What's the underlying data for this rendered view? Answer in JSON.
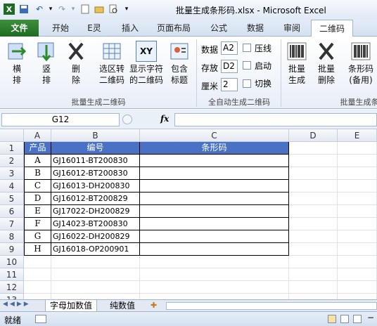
{
  "window": {
    "title": "批量生成条形码.xlsx - Microsoft Excel"
  },
  "tabs": [
    "文件",
    "开始",
    "E灵",
    "插入",
    "页面布局",
    "公式",
    "数据",
    "审阅",
    "二维码"
  ],
  "ribbon": {
    "group1": {
      "label": "批量生成二维码",
      "buttons": [
        "横\n排",
        "竖\n排",
        "删\n除",
        "选区转\n二维码",
        "显示字符\n的二维码",
        "包含\n标题"
      ]
    },
    "group2": {
      "label": "全自动生成二维码",
      "rows": [
        {
          "label": "数据",
          "value": "A2",
          "check": "压线"
        },
        {
          "label": "存放",
          "value": "D2",
          "check": "启动"
        },
        {
          "label": "厘米",
          "value": "2",
          "check": "切换"
        }
      ]
    },
    "group3": {
      "label": "批量生成条",
      "buttons": [
        "批量\n生成",
        "批量\n删除",
        "条形码\n(备用)"
      ]
    },
    "icon_text_xy": "XY"
  },
  "formula_bar": {
    "name_box": "G12",
    "fx": "fx"
  },
  "columns": [
    "A",
    "B",
    "C",
    "D",
    "E"
  ],
  "rows": [
    "1",
    "2",
    "3",
    "4",
    "5",
    "6",
    "7",
    "8",
    "9",
    "10",
    "11",
    "12",
    "13"
  ],
  "table": {
    "headers": [
      "产品",
      "编号",
      "条形码"
    ],
    "rows": [
      [
        "A",
        "GJ16011-BT200830"
      ],
      [
        "B",
        "GJ16012-BT200830"
      ],
      [
        "C",
        "GJ16013-DH200830"
      ],
      [
        "D",
        "GJ16012-BT200829"
      ],
      [
        "E",
        "GJ17022-DH200829"
      ],
      [
        "F",
        "GJ14023-BT200830"
      ],
      [
        "G",
        "GJ16022-DH200829"
      ],
      [
        "H",
        "GJ16018-OP200901"
      ]
    ]
  },
  "sheet_tabs": [
    "字母加数值",
    "纯数值"
  ],
  "status": {
    "ready": "就绪"
  },
  "colors": {
    "header_fill": "#4a72c4",
    "file_tab": "#2e7d32"
  }
}
